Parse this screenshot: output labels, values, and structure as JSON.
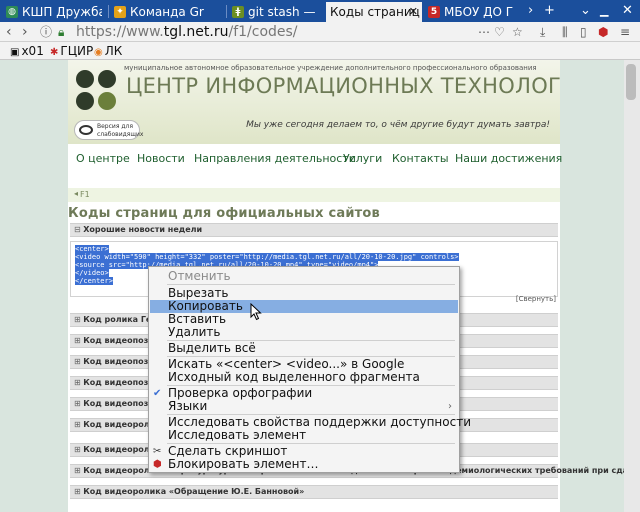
{
  "tabs": [
    {
      "label": "КШП Дружба",
      "favicon": "globe-icon"
    },
    {
      "label": "Команда Gr",
      "favicon": "bulb-icon"
    },
    {
      "label": "git stash —",
      "favicon": "git-icon"
    },
    {
      "label": "Коды страниц",
      "favicon": "page-icon",
      "active": true
    },
    {
      "label": "МБОУ ДО Г",
      "favicon": "school-icon"
    }
  ],
  "url": {
    "scheme": "https://www.",
    "host": "tgl.net.ru",
    "path": "/f1/codes/"
  },
  "bookmarks": [
    {
      "label": "x01"
    },
    {
      "label": "ГЦИР"
    },
    {
      "label": "ЛК"
    }
  ],
  "site": {
    "org_small": "муниципальное автономное образовательное учреждение дополнительного профессионального образования",
    "org_title": "ЦЕНТР ИНФОРМАЦИОННЫХ ТЕХНОЛОГИЙ",
    "slogan": "Мы уже сегодня делаем то, о чём другие будут думать завтра!",
    "vision_label": "Версия для слабовидящих",
    "menu": [
      "О центре",
      "Новости",
      "Направления деятельности",
      "Услуги",
      "Контакты",
      "Наши достижения"
    ],
    "breadcrumb": "F1",
    "heading": "Коды страниц для официальных сайтов",
    "open_section": "Хорошие новости недели",
    "code_lines": [
      "<center>",
      "    <video width=\"590\" height=\"332\" poster=\"http://media.tgl.net.ru/all/20-10-20.jpg\" controls>",
      "        <source src=\"http://media.tgl.net.ru/all/20-10-20.mp4\" type=\"video/mp4\">",
      "    </video>",
      "</center>"
    ],
    "collapse_label": "[Свернуть]",
    "sections": [
      "Код ролика Генера",
      "Код видеопоздрав",
      "Код видеопоздрав",
      "Код видеопоздрав",
      "Код видеопоздрав",
      "Код видеоролика",
      "Код видеоролика «",
      "Код видеоролика «Прокуратура Самарской обл. о соблюдении санитарно-эпидемиологических требований при сдаче ЕГЭ»",
      "Код видеоролика «Обращение Ю.Е. Банновой»"
    ]
  },
  "context_menu": {
    "items": [
      {
        "label": "Отменить",
        "disabled": true
      },
      {
        "label": "Вырезать"
      },
      {
        "label": "Копировать",
        "highlighted": true
      },
      {
        "label": "Вставить"
      },
      {
        "label": "Удалить"
      },
      {
        "label": "Выделить всё"
      },
      {
        "label": "Искать «<center> <video...» в Google"
      },
      {
        "label": "Исходный код выделенного фрагмента"
      },
      {
        "label": "Проверка орфографии",
        "checked": true
      },
      {
        "label": "Языки",
        "submenu": true
      },
      {
        "label": "Исследовать свойства поддержки доступности"
      },
      {
        "label": "Исследовать элемент"
      },
      {
        "label": "Сделать скриншот",
        "icon": "scissors-icon"
      },
      {
        "label": "Блокировать элемент…",
        "icon": "shield-icon"
      }
    ]
  },
  "colors": {
    "tabbar": "#1b4f9c",
    "accent_green": "#1f5f2e",
    "selection": "#3b6fd3",
    "menu_highlight": "#86aee2"
  }
}
